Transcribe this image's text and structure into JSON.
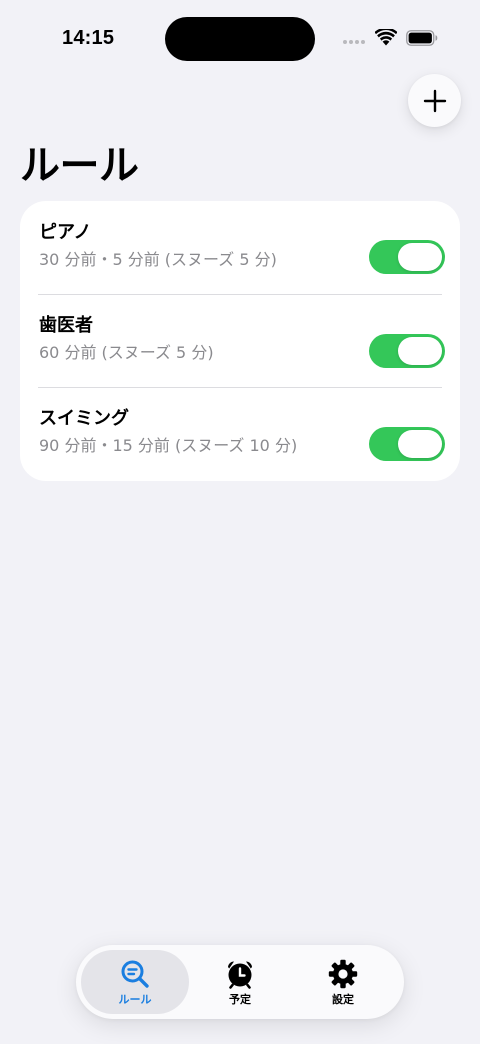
{
  "status_bar": {
    "time": "14:15"
  },
  "header": {
    "title": "ルール"
  },
  "rules": [
    {
      "name": "ピアノ",
      "detail": "30 分前・5 分前 (スヌーズ 5 分)",
      "enabled": true
    },
    {
      "name": "歯医者",
      "detail": "60 分前 (スヌーズ 5 分)",
      "enabled": true
    },
    {
      "name": "スイミング",
      "detail": "90 分前・15 分前 (スヌーズ 10 分)",
      "enabled": true
    }
  ],
  "tab_bar": {
    "active": "ルール",
    "tabs": [
      {
        "label": "ルール",
        "icon": "search-list-icon"
      },
      {
        "label": "予定",
        "icon": "alarm-clock-icon"
      },
      {
        "label": "設定",
        "icon": "gear-icon"
      }
    ]
  },
  "colors": {
    "accent": "#1a7ee0",
    "toggle_on": "#34c759",
    "background": "#f2f2f7"
  }
}
